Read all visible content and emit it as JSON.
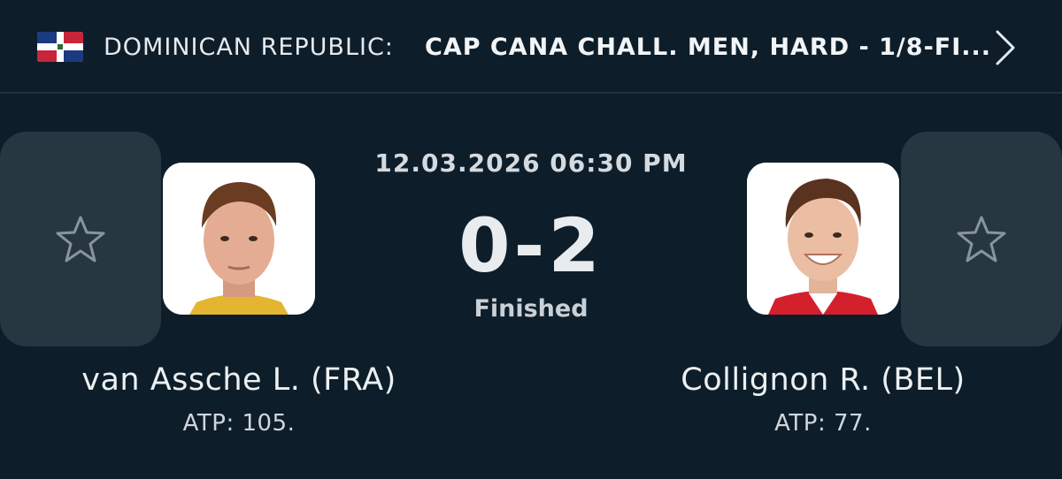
{
  "header": {
    "country": "DOMINICAN REPUBLIC:",
    "tournament": "CAP CANA CHALL. MEN, HARD - 1/8-FI...",
    "flag_icon": "dominican-republic-flag",
    "chevron_icon": "chevron-right-icon"
  },
  "match": {
    "datetime": "12.03.2026 06:30 PM",
    "score": "0-2",
    "status": "Finished"
  },
  "players": [
    {
      "name": "van Assche L. (FRA)",
      "ranking": "ATP: 105.",
      "favorite_icon": "star-outline-icon",
      "avatar": "player-photo"
    },
    {
      "name": "Collignon R. (BEL)",
      "ranking": "ATP: 77.",
      "favorite_icon": "star-outline-icon",
      "avatar": "player-photo"
    }
  ],
  "colors": {
    "background": "#0d1e2a",
    "card": "#273742",
    "flag_blue": "#1b3a80",
    "flag_red": "#c8253a"
  }
}
